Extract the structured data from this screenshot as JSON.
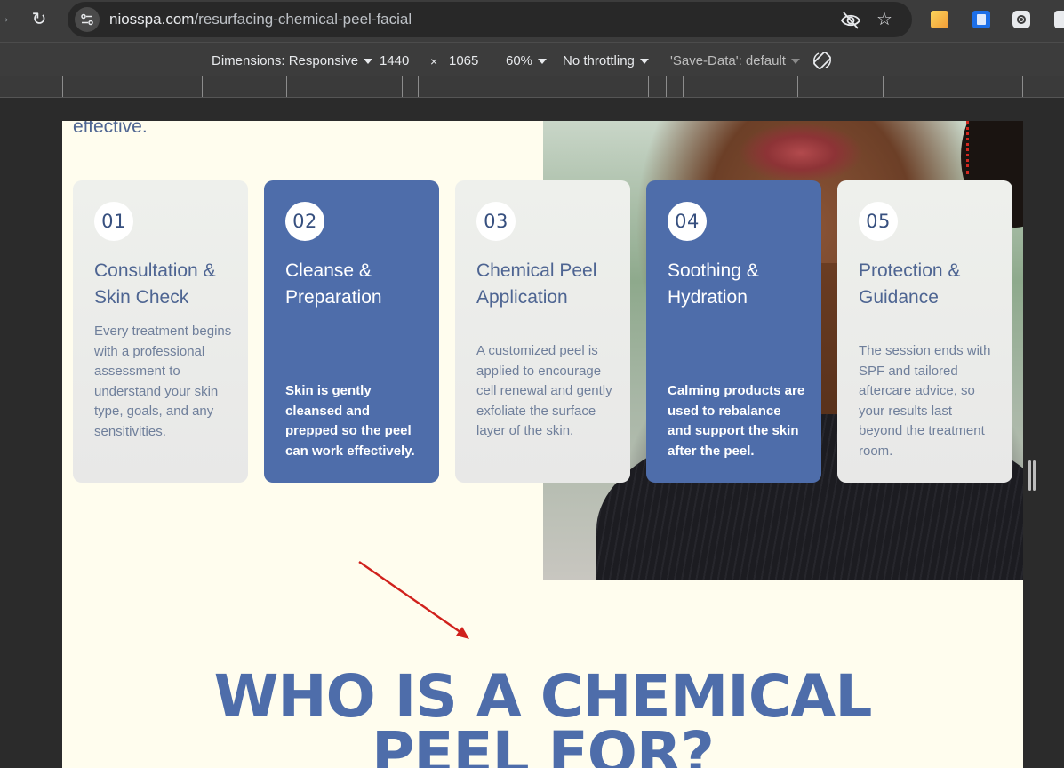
{
  "browser": {
    "url_host": "niosspa.com",
    "url_path": "/resurfacing-chemical-peel-facial"
  },
  "devtools": {
    "dimensions_label": "Dimensions: Responsive",
    "width": "1440",
    "times": "×",
    "height": "1065",
    "zoom": "60%",
    "throttling": "No throttling",
    "save_data": "'Save-Data': default"
  },
  "page": {
    "lead_text": "effective.",
    "steps": [
      {
        "number": "01",
        "title": "Consultation & Skin Check",
        "body": "Every treatment begins with a professional assessment to understand your skin type, goals, and any sensitivities."
      },
      {
        "number": "02",
        "title": "Cleanse & Preparation",
        "body": "Skin is gently cleansed and prepped so the peel can work effectively."
      },
      {
        "number": "03",
        "title": "Chemical Peel Application",
        "body": "A customized peel is applied to encourage cell renewal and gently exfoliate the surface layer of the skin."
      },
      {
        "number": "04",
        "title": "Soothing & Hydration",
        "body": "Calming products are used to rebalance and support the skin after the peel."
      },
      {
        "number": "05",
        "title": "Protection & Guidance",
        "body": "The session ends with SPF and tailored aftercare advice, so your results last beyond the treatment room."
      }
    ],
    "heading_line1": "WHO IS A CHEMICAL",
    "heading_line2": "PEEL FOR?"
  },
  "colors": {
    "accent_blue": "#4e6daa",
    "page_bg": "#fffdee",
    "annotation_arrow": "#d0211c"
  }
}
